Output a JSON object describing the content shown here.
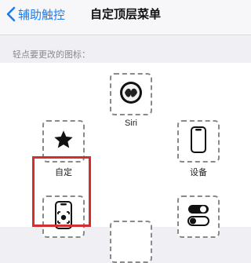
{
  "nav": {
    "back_label": "辅助触控",
    "title": "自定顶层菜单"
  },
  "hint": "轻点要更改的图标：",
  "icons": {
    "siri": {
      "label": "Siri"
    },
    "custom": {
      "label": "自定"
    },
    "device": {
      "label": "设备"
    }
  },
  "colors": {
    "accent": "#1a7cf5",
    "highlight": "#d42e2e"
  }
}
